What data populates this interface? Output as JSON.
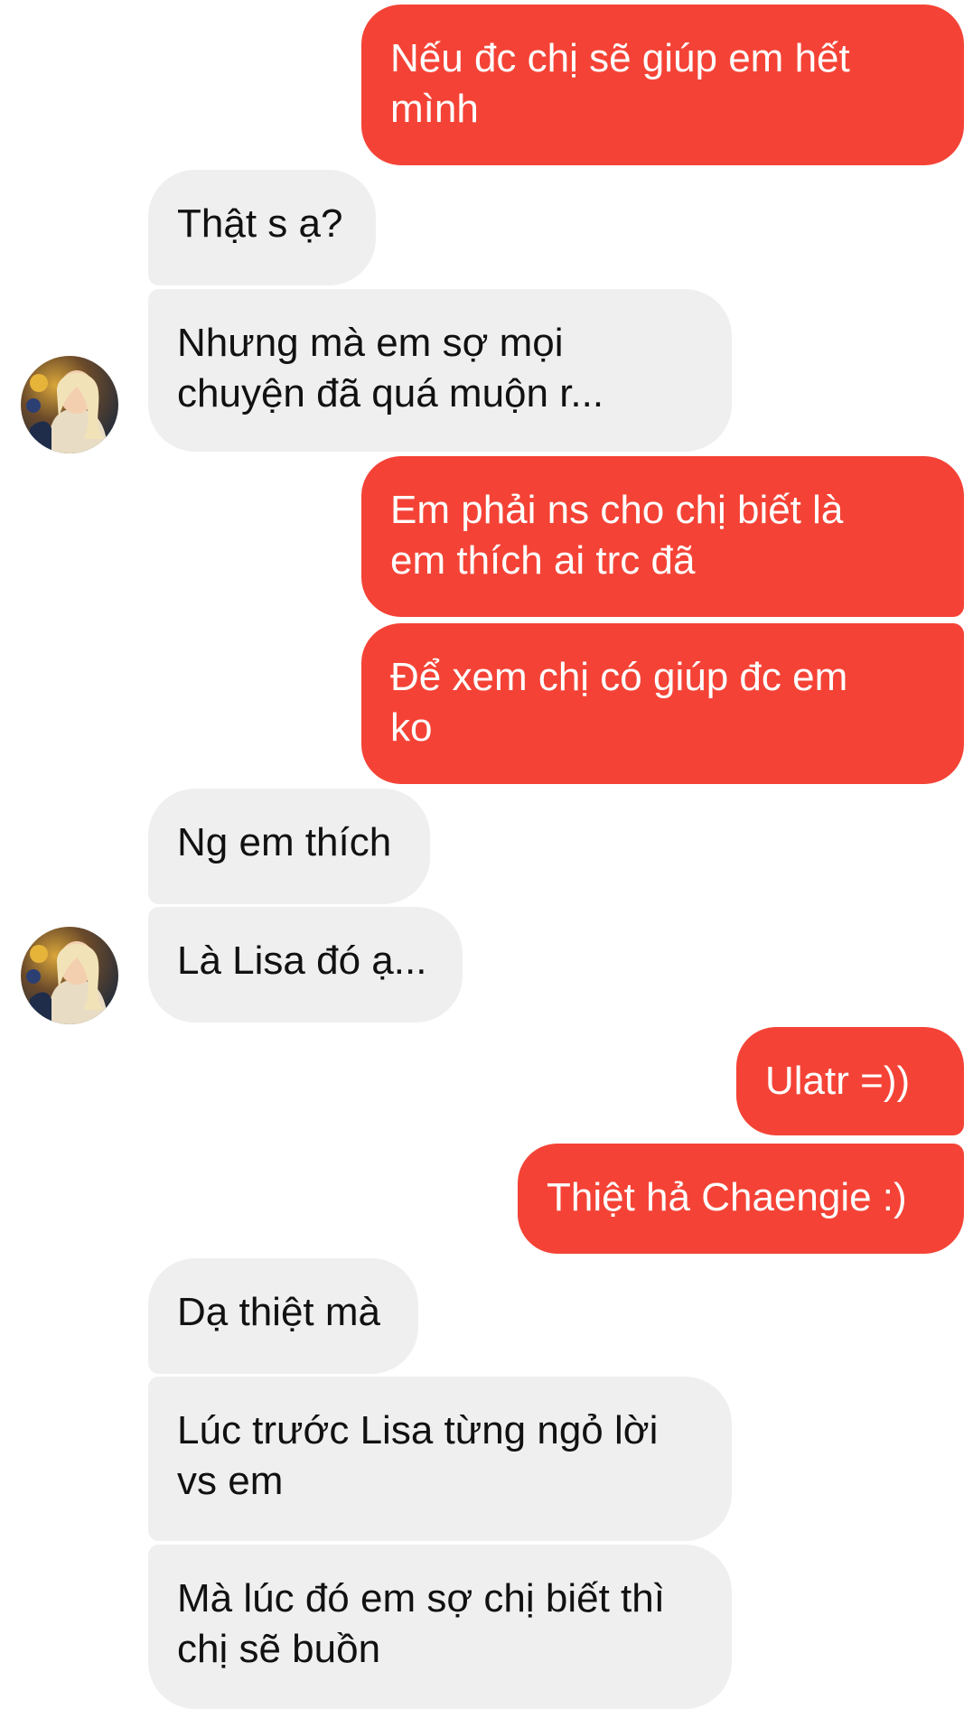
{
  "conversation": {
    "contact_avatar": "avatar-photo",
    "colors": {
      "sent_bubble": "#f44336",
      "sent_text": "#ffffff",
      "received_bubble": "#efefef",
      "received_text": "#111111"
    },
    "messages": [
      {
        "from": "me",
        "text": "Nếu đc chị sẽ giúp em hết\nmình"
      },
      {
        "from": "contact",
        "text": "Thật s ạ?"
      },
      {
        "from": "contact",
        "text": "Nhưng mà em sợ mọi\nchuyện đã quá muộn r..."
      },
      {
        "from": "me",
        "text": "Em phải ns cho chị biết là\nem thích ai trc đã"
      },
      {
        "from": "me",
        "text": "Để xem chị có giúp đc em\nko"
      },
      {
        "from": "contact",
        "text": "Ng em thích"
      },
      {
        "from": "contact",
        "text": "Là Lisa đó ạ..."
      },
      {
        "from": "me",
        "text": "Ulatr =))"
      },
      {
        "from": "me",
        "text": "Thiệt hả Chaengie :)"
      },
      {
        "from": "contact",
        "text": "Dạ thiệt mà"
      },
      {
        "from": "contact",
        "text": "Lúc trước Lisa từng ngỏ lời\nvs em"
      },
      {
        "from": "contact",
        "text": "Mà lúc đó em sợ chị biết thì\nchị sẽ buồn"
      }
    ]
  }
}
